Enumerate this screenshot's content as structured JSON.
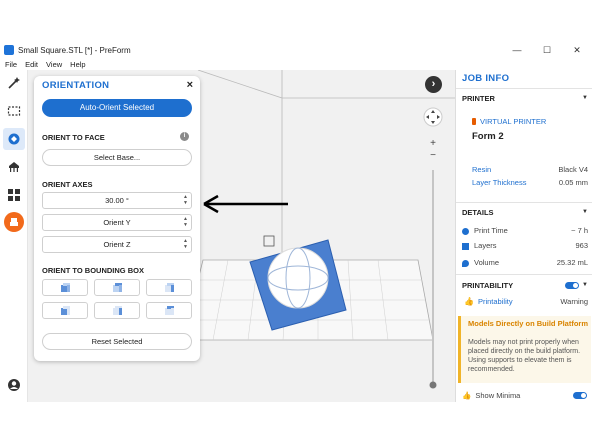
{
  "window": {
    "title": "Small Square.STL [*] - PreForm",
    "controls": [
      "—",
      "☐",
      "✕"
    ]
  },
  "menu": [
    "File",
    "Edit",
    "View",
    "Help"
  ],
  "orientation": {
    "title": "ORIENTATION",
    "close": "×",
    "auto_orient": "Auto-Orient Selected",
    "orient_to_face": "ORIENT TO FACE",
    "info": "i",
    "select_base": "Select Base...",
    "orient_axes": "ORIENT AXES",
    "angle": "30.00 °",
    "orient_y": "Orient Y",
    "orient_z": "Orient Z",
    "orient_bbox": "ORIENT TO BOUNDING BOX",
    "reset": "Reset Selected"
  },
  "job": {
    "title": "JOB INFO",
    "printer_section": "PRINTER",
    "virtual_printer": "VIRTUAL PRINTER",
    "printer_name": "Form 2",
    "resin_label": "Resin",
    "resin_value": "Black V4",
    "layer_label": "Layer Thickness",
    "layer_value": "0.05 mm",
    "details_section": "DETAILS",
    "print_time_label": "Print Time",
    "print_time_value": "~ 7 h",
    "layers_label": "Layers",
    "layers_value": "963",
    "volume_label": "Volume",
    "volume_value": "25.32 mL",
    "printability_section": "PRINTABILITY",
    "printability_label": "Printability",
    "printability_value": "Warning",
    "warning_title": "Models Directly on Build Platform",
    "warning_body": "Models may not print properly when placed directly on the build platform. Using supports to elevate them is recommended.",
    "show_minima": "Show Minima"
  },
  "viewport": {
    "next_arrow": "›",
    "zoom_in": "+",
    "zoom_out": "−"
  }
}
